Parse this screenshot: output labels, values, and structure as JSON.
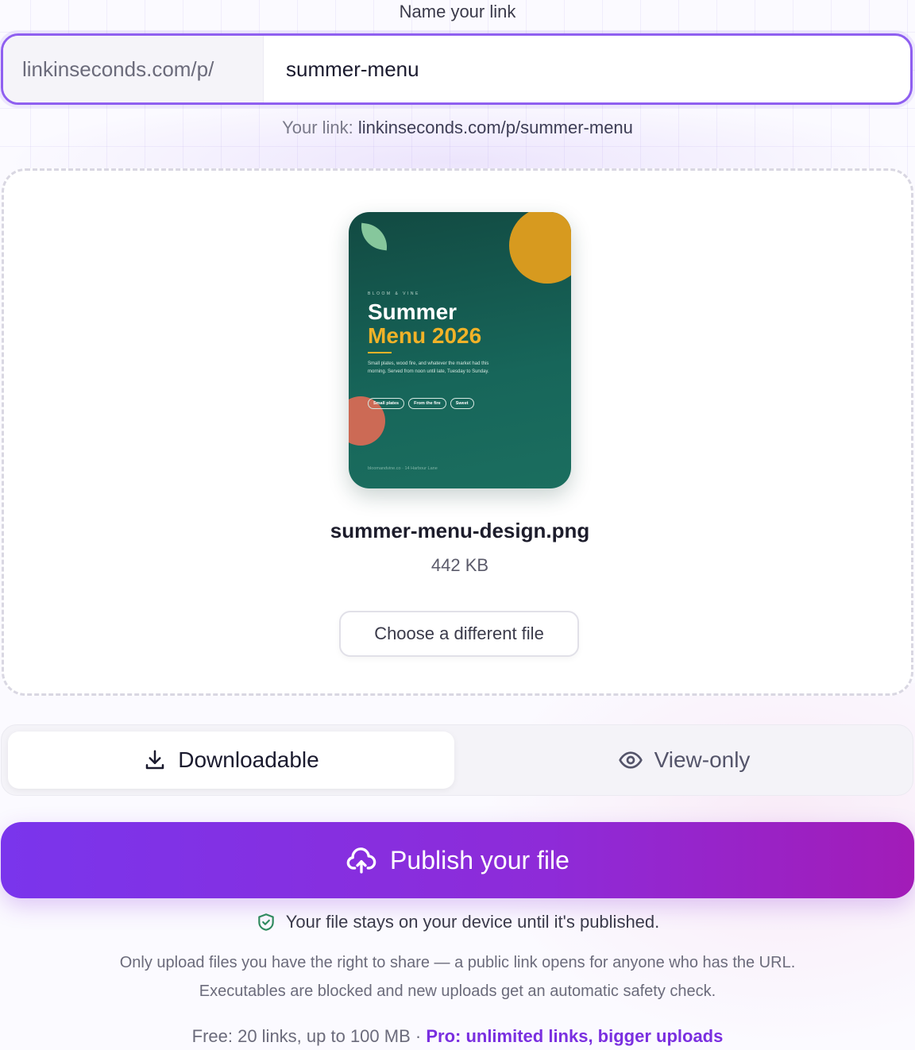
{
  "link_form": {
    "label": "Name your link",
    "prefix": "linkinseconds.com/p/",
    "slug": "summer-menu",
    "preview_label": "Your link:",
    "preview_url": "linkinseconds.com/p/summer-menu"
  },
  "file": {
    "name": "summer-menu-design.png",
    "size": "442 KB",
    "change_label": "Choose a different file",
    "thumbnail": {
      "brand": "BLOOM & VINE",
      "title_line1": "Summer",
      "title_line2": "Menu 2026",
      "blurb": "Small plates, wood fire, and whatever the market had this morning. Served from noon until late, Tuesday to Sunday.",
      "chips": [
        "Small plates",
        "From the fire",
        "Sweet"
      ],
      "footer": "bloomandvine.co · 14 Harbour Lane"
    }
  },
  "access_toggle": {
    "options": [
      {
        "label": "Downloadable",
        "icon": "download-icon",
        "selected": true
      },
      {
        "label": "View-only",
        "icon": "eye-icon",
        "selected": false
      }
    ]
  },
  "publish": {
    "label": "Publish your file",
    "icon": "cloud-upload-icon"
  },
  "notes": {
    "safety": "Your file stays on your device until it's published.",
    "disclaimer": "Only upload files you have the right to share — a public link opens for anyone who has the URL. Executables are blocked and new uploads get an automatic safety check.",
    "plan_free": "Free: 20 links, up to 100 MB ·",
    "plan_pro": "Pro: unlimited links, bigger uploads"
  },
  "colors": {
    "accent": "#8f5ff0",
    "publish_start": "#7a35ec",
    "publish_end": "#a21cb8",
    "pro_link": "#7a2fe0"
  }
}
